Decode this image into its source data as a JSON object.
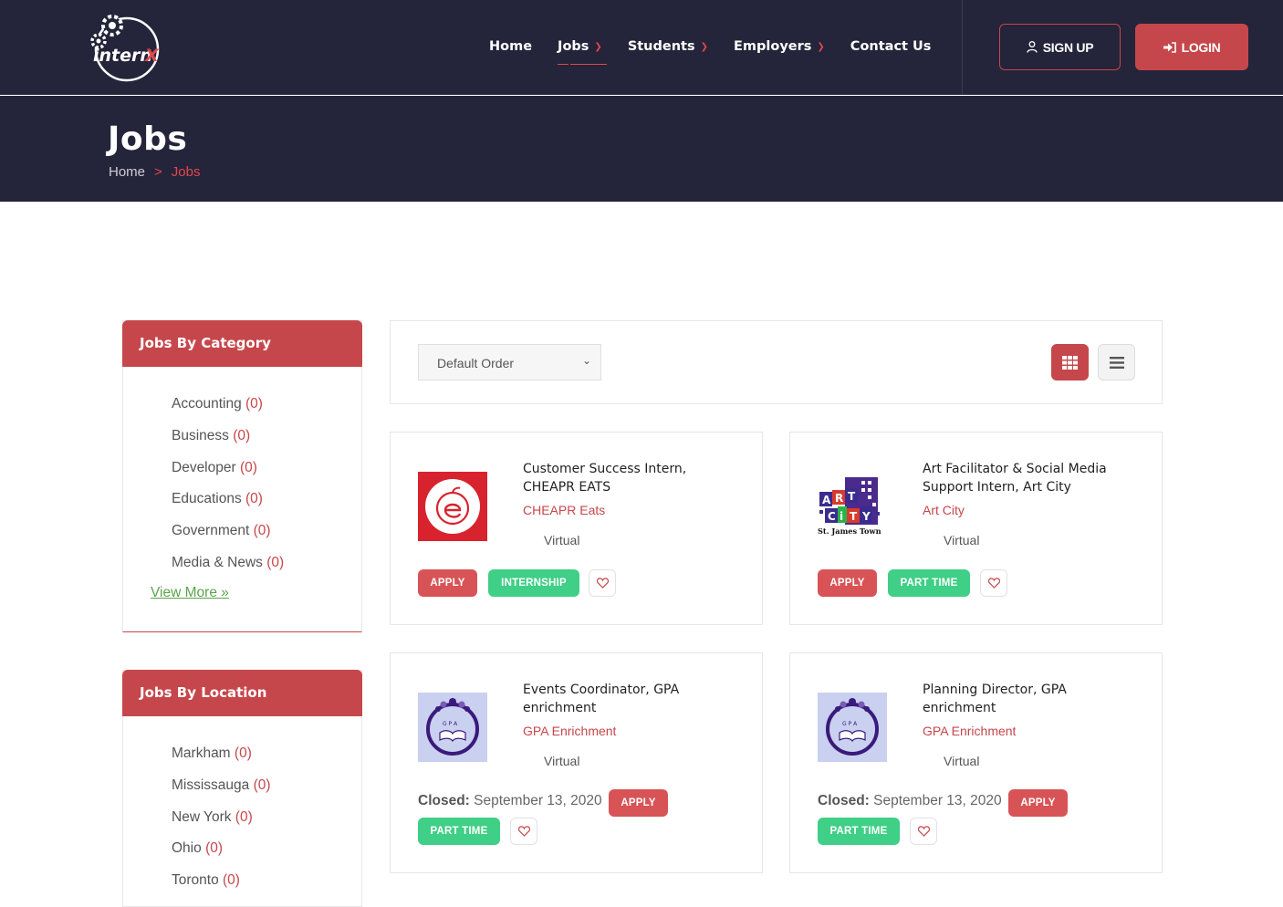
{
  "brand": {
    "logo_text": "internX"
  },
  "nav": {
    "items": [
      {
        "label": "Home",
        "dropdown": false
      },
      {
        "label": "Jobs",
        "dropdown": true,
        "active": true
      },
      {
        "label": "Students",
        "dropdown": true
      },
      {
        "label": "Employers",
        "dropdown": true
      },
      {
        "label": "Contact Us",
        "dropdown": false
      }
    ],
    "signup_label": "SIGN UP",
    "login_label": "LOGIN"
  },
  "hero": {
    "title": "Jobs",
    "breadcrumb": {
      "home": "Home",
      "separator": ">",
      "current": "Jobs"
    }
  },
  "sidebar": {
    "category": {
      "title": "Jobs By Category",
      "items": [
        {
          "name": "Accounting",
          "count": "(0)"
        },
        {
          "name": "Business",
          "count": "(0)"
        },
        {
          "name": "Developer",
          "count": "(0)"
        },
        {
          "name": "Educations",
          "count": "(0)"
        },
        {
          "name": "Government",
          "count": "(0)"
        },
        {
          "name": "Media & News",
          "count": "(0)"
        }
      ],
      "view_more": "View More"
    },
    "location": {
      "title": "Jobs By Location",
      "items": [
        {
          "name": "Markham",
          "count": "(0)"
        },
        {
          "name": "Mississauga",
          "count": "(0)"
        },
        {
          "name": "New York",
          "count": "(0)"
        },
        {
          "name": "Ohio",
          "count": "(0)"
        },
        {
          "name": "Toronto",
          "count": "(0)"
        }
      ]
    }
  },
  "toolbar": {
    "sort_value": "Default Order"
  },
  "jobs": [
    {
      "title": "Customer Success Intern, CHEAPR EATS",
      "company": "CHEAPR Eats",
      "location": "Virtual",
      "apply": "APPLY",
      "type": "INTERNSHIP"
    },
    {
      "title": "Art Facilitator & Social Media Support Intern, Art City",
      "company": "Art City",
      "location": "Virtual",
      "apply": "APPLY",
      "type": "PART TIME",
      "logo_caption": "St. James Town"
    },
    {
      "title": "Events Coordinator, GPA enrichment",
      "company": "GPA Enrichment",
      "location": "Virtual",
      "closed_label": "Closed:",
      "closed_date": "September 13, 2020",
      "apply": "APPLY",
      "type": "PART TIME",
      "logo_text": "G P A"
    },
    {
      "title": "Planning Director, GPA enrichment",
      "company": "GPA Enrichment",
      "location": "Virtual",
      "closed_label": "Closed:",
      "closed_date": "September 13, 2020",
      "apply": "APPLY",
      "type": "PART TIME",
      "logo_text": "G P A"
    }
  ],
  "colors": {
    "header_bg": "#24243a",
    "accent": "#c6474b",
    "green": "#3fcf86",
    "link_green": "#5aa34c"
  }
}
